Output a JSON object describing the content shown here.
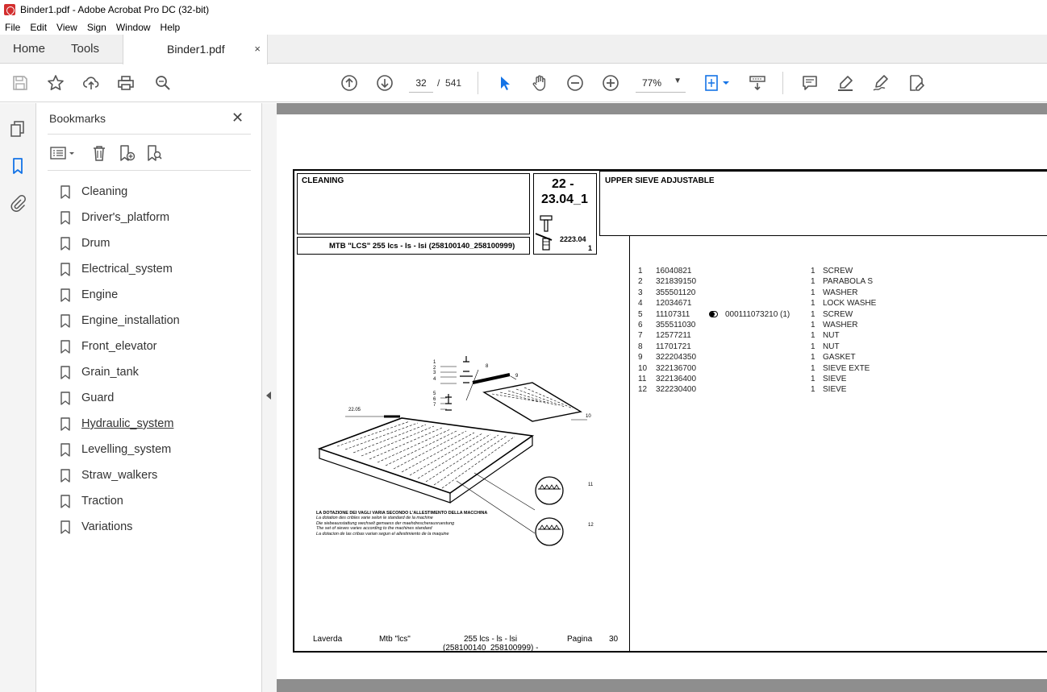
{
  "window": {
    "title": "Binder1.pdf - Adobe Acrobat Pro DC (32-bit)"
  },
  "menu": [
    "File",
    "Edit",
    "View",
    "Sign",
    "Window",
    "Help"
  ],
  "tabs": {
    "home": "Home",
    "tools": "Tools",
    "document": "Binder1.pdf",
    "close_glyph": "×"
  },
  "toolbar": {
    "current_page": "32",
    "page_separator": "/",
    "total_pages": "541",
    "zoom": "77%",
    "icons": [
      "save-icon",
      "star-icon",
      "upload-icon",
      "print-icon",
      "find-icon",
      "page-up-icon",
      "page-down-icon",
      "select-cursor-icon",
      "hand-icon",
      "zoom-out-icon",
      "zoom-in-icon",
      "fit-page-icon",
      "scroll-mode-icon",
      "comment-icon",
      "highlight-icon",
      "fill-sign-icon",
      "edit-pdf-icon"
    ]
  },
  "bookmarks": {
    "title": "Bookmarks",
    "close_glyph": "✕",
    "items": [
      {
        "label": "Cleaning"
      },
      {
        "label": "Driver's_platform"
      },
      {
        "label": "Drum"
      },
      {
        "label": "Electrical_system"
      },
      {
        "label": "Engine"
      },
      {
        "label": "Engine_installation"
      },
      {
        "label": "Front_elevator"
      },
      {
        "label": "Grain_tank"
      },
      {
        "label": "Guard"
      },
      {
        "label": "Hydraulic_system"
      },
      {
        "label": "Levelling_system"
      },
      {
        "label": "Straw_walkers"
      },
      {
        "label": "Traction"
      },
      {
        "label": "Variations"
      }
    ]
  },
  "document": {
    "section": "CLEANING",
    "model_line": "MTB \"LCS\" 255 lcs - ls - lsi (258100140_258100999)",
    "code_top": "22 -",
    "code_bottom": "23.04_1",
    "code_small": "2223.04",
    "code_small_sub": "1",
    "heading": "UPPER SIEVE ADJUSTABLE",
    "diagram": {
      "callouts": [
        "1",
        "2",
        "3",
        "4",
        "5",
        "6",
        "7",
        "8",
        "9",
        "10",
        "11",
        "12"
      ],
      "ref_label": "22.05",
      "note_lines": [
        "LA DOTAZIONE DEI VAGLI VARIA SECONDO L'ALLESTIMENTO DELLA MACCHINA",
        "La dotation des cribles varie selon le standard de la machine",
        "Die siebeausstattung wechselt gemaess der maehdrescherausruestung",
        "The set of sieves varies according to the machines standard",
        "La dotacion de las cribas varian segun el allestimiento de la maquine"
      ]
    },
    "parts": [
      {
        "no": "1",
        "code": "16040821",
        "sub": "",
        "qty": "1",
        "desc": "SCREW"
      },
      {
        "no": "2",
        "code": "321839150",
        "sub": "",
        "qty": "1",
        "desc": "PARABOLA S"
      },
      {
        "no": "3",
        "code": "355501120",
        "sub": "",
        "qty": "1",
        "desc": "WASHER"
      },
      {
        "no": "4",
        "code": "12034671",
        "sub": "",
        "qty": "1",
        "desc": "LOCK WASHE"
      },
      {
        "no": "5",
        "code": "11107311",
        "sub": "000111073210  (1)",
        "qty": "1",
        "desc": "SCREW"
      },
      {
        "no": "6",
        "code": "355511030",
        "sub": "",
        "qty": "1",
        "desc": "WASHER"
      },
      {
        "no": "7",
        "code": "12577211",
        "sub": "",
        "qty": "1",
        "desc": "NUT"
      },
      {
        "no": "8",
        "code": "11701721",
        "sub": "",
        "qty": "1",
        "desc": "NUT"
      },
      {
        "no": "9",
        "code": "322204350",
        "sub": "",
        "qty": "1",
        "desc": "GASKET"
      },
      {
        "no": "10",
        "code": "322136700",
        "sub": "",
        "qty": "1",
        "desc": "SIEVE EXTE"
      },
      {
        "no": "11",
        "code": "322136400",
        "sub": "",
        "qty": "1",
        "desc": "SIEVE"
      },
      {
        "no": "12",
        "code": "322230400",
        "sub": "",
        "qty": "1",
        "desc": "SIEVE"
      }
    ],
    "footer": {
      "brand": "Laverda",
      "model": "Mtb \"lcs\"",
      "variant": "255 lcs - ls - lsi",
      "range": "(258100140_258100999) -",
      "page_label": "Pagina",
      "page_number": "30"
    }
  }
}
